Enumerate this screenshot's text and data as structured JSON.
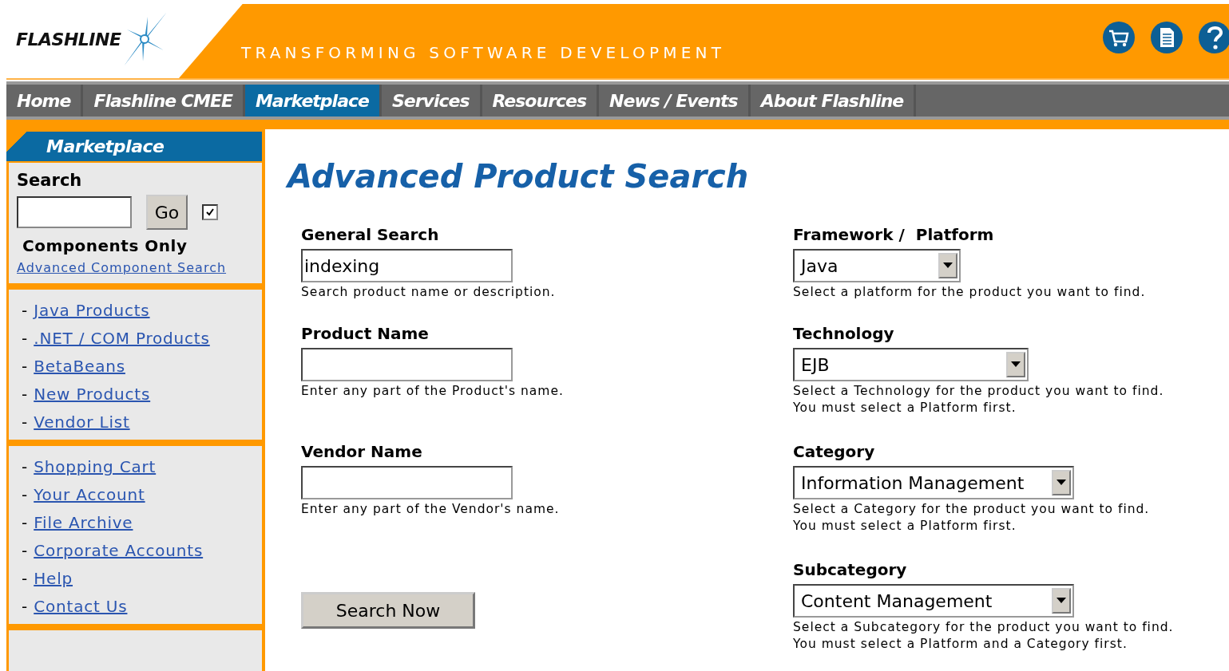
{
  "header": {
    "logo": "FLASHLINE",
    "tagline": "TRANSFORMING SOFTWARE DEVELOPMENT"
  },
  "nav": [
    {
      "label": "Home",
      "selected": false
    },
    {
      "label": "Flashline CMEE",
      "selected": false
    },
    {
      "label": "Marketplace",
      "selected": true
    },
    {
      "label": "Services",
      "selected": false
    },
    {
      "label": "Resources",
      "selected": false
    },
    {
      "label": "News / Events",
      "selected": false
    },
    {
      "label": "About Flashline",
      "selected": false
    }
  ],
  "sidebar": {
    "title": "Marketplace",
    "search": {
      "label": "Search",
      "button": "Go",
      "checkbox": {
        "label": "Components Only",
        "checked": true
      },
      "link": "Advanced Component Search"
    },
    "link_groups": [
      [
        {
          "marker": "-",
          "label": "Java Products"
        },
        {
          "marker": "-",
          "label": ".NET / COM Products"
        },
        {
          "marker": "-",
          "label": "BetaBeans"
        },
        {
          "marker": "-",
          "label": "New Products"
        },
        {
          "marker": "-",
          "label": "Vendor List"
        }
      ],
      [
        {
          "marker": "-",
          "label": "Shopping Cart"
        },
        {
          "marker": "-",
          "label": "Your Account"
        },
        {
          "marker": "-",
          "label": "File Archive"
        },
        {
          "marker": "-",
          "label": "Corporate Accounts"
        },
        {
          "marker": "-",
          "label": "Help"
        },
        {
          "marker": "-",
          "label": "Contact Us"
        }
      ]
    ]
  },
  "main": {
    "title": "Advanced Product Search",
    "left_fields": [
      {
        "kind": "text",
        "label": "General Search",
        "value": "indexing",
        "hint": [
          "Search product name or description."
        ]
      },
      {
        "kind": "text",
        "label": "Product Name",
        "hint": [
          "Enter any part of the Product's name."
        ]
      },
      {
        "kind": "text",
        "label": "Vendor Name",
        "hint": [
          "Enter any part of the Vendor's name."
        ]
      },
      {
        "kind": "button",
        "label": "Search Now"
      }
    ],
    "right_fields": [
      {
        "kind": "select",
        "label": "Framework /  Platform",
        "value": "Java",
        "hint": [
          "Select a platform for the product you want to find."
        ]
      },
      {
        "kind": "select",
        "label": "Technology",
        "value": "EJB",
        "hint": [
          "Select a Technology for the product you want to find.",
          "You must select a Platform first."
        ]
      },
      {
        "kind": "select",
        "label": "Category",
        "value": "Information Management",
        "hint": [
          "Select a Category for the product you want to find.",
          "You must select a Platform first."
        ]
      },
      {
        "kind": "select",
        "label": "Subcategory",
        "value": "Content Management",
        "hint": [
          "Select a Subcategory for the product you want to find.",
          "You must select a Platform and a Category first."
        ]
      }
    ]
  }
}
